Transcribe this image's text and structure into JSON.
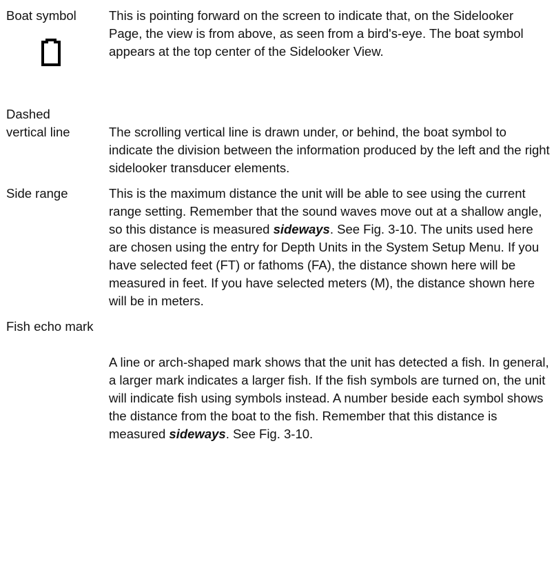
{
  "entries": {
    "boat_symbol": {
      "term": "Boat symbol",
      "icon": "boat-outline-icon",
      "description": "This is pointing forward on the screen to indicate that, on the Sidelooker Page, the view is from above, as seen from a bird's-eye. The boat symbol appears at the top center of the Sidelooker View."
    },
    "dashed_vertical_line": {
      "term_line1": "Dashed",
      "term_line2": "vertical line",
      "description": "The scrolling vertical line is drawn under, or behind, the boat symbol to indicate the division between the information produced by the left and the right sidelooker transducer elements."
    },
    "side_range": {
      "term": "Side range",
      "description_part1": "This is the maximum distance the unit will be able to see using the current range setting.  Remember that the sound waves move out at a shallow angle, so this distance is measured ",
      "emphasis": "sideways",
      "description_part2": ".  See Fig. 3-10.  The units used here are chosen using the entry for Depth Units in the System Setup Menu.  If you have selected feet (FT) or fathoms (FA), the distance shown here will be measured in feet.  If you have selected meters (M), the distance shown here will be in meters."
    },
    "fish_echo_mark": {
      "term": "Fish echo mark",
      "description_part1": "A line or arch-shaped mark shows that the unit has detected a fish.  In general, a larger mark indicates a larger fish.  If the fish symbols are turned on, the unit will indicate fish using symbols instead.  A number beside each symbol shows the distance from the boat to the fish.  Remember that this distance is measured ",
      "emphasis": "sideways",
      "description_part2": ".  See Fig. 3-10."
    }
  }
}
